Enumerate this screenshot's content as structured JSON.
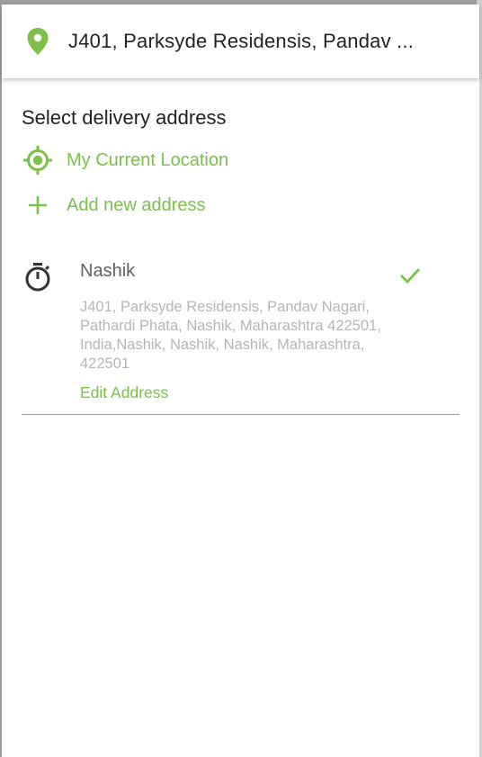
{
  "header": {
    "selected_address": "J401, Parksyde Residensis, Pandav ...",
    "pin_icon": "location-pin-icon"
  },
  "picker": {
    "title": "Select delivery address",
    "current_location_label": "My Current Location",
    "add_new_label": "Add new address"
  },
  "addresses": [
    {
      "name": "Nashik",
      "full_address": "J401, Parksyde Residensis, Pandav Nagari, Pathardi Phata, Nashik, Maharashtra 422501, India,Nashik, Nashik, Nashik, Maharashtra, 422501",
      "edit_label": "Edit Address",
      "selected": true
    }
  ],
  "colors": {
    "accent": "#7cc049",
    "title_text": "#212121",
    "muted_text": "#b5b5b5"
  }
}
